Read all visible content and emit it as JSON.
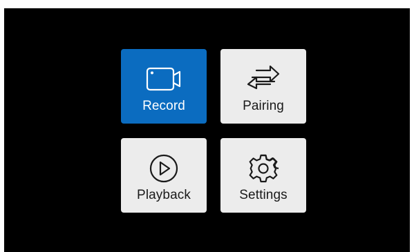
{
  "menu": {
    "items": [
      {
        "label": "Record",
        "icon": "video-camera-icon",
        "selected": true
      },
      {
        "label": "Pairing",
        "icon": "swap-arrows-icon",
        "selected": false
      },
      {
        "label": "Playback",
        "icon": "play-circle-icon",
        "selected": false
      },
      {
        "label": "Settings",
        "icon": "gear-icon",
        "selected": false
      }
    ]
  },
  "colors": {
    "background": "#000000",
    "selected_tile": "#0b6cc0",
    "tile": "#ececec",
    "selected_text": "#ffffff",
    "text": "#1a1a1a"
  }
}
